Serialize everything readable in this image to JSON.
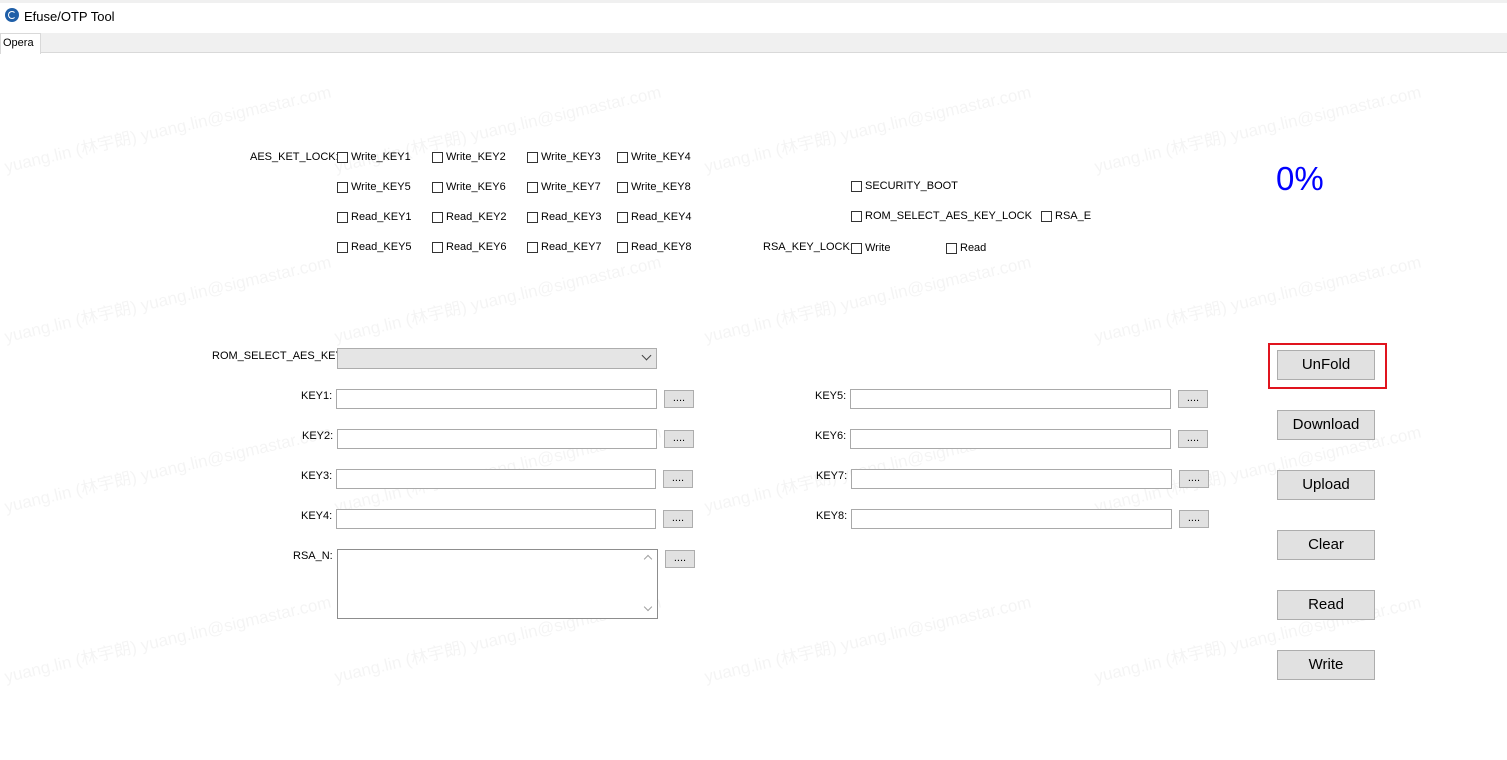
{
  "window": {
    "title": "Efuse/OTP Tool"
  },
  "tabs": [
    {
      "label": "Opera"
    }
  ],
  "aes_lock": {
    "label": "AES_KET_LOCK:",
    "rows": [
      [
        "Write_KEY1",
        "Write_KEY2",
        "Write_KEY3",
        "Write_KEY4"
      ],
      [
        "Write_KEY5",
        "Write_KEY6",
        "Write_KEY7",
        "Write_KEY8"
      ],
      [
        "Read_KEY1",
        "Read_KEY2",
        "Read_KEY3",
        "Read_KEY4"
      ],
      [
        "Read_KEY5",
        "Read_KEY6",
        "Read_KEY7",
        "Read_KEY8"
      ]
    ]
  },
  "security_boot": "SECURITY_BOOT",
  "rom_select_aes_key_lock": "ROM_SELECT_AES_KEY_LOCK",
  "rsa_e": "RSA_E",
  "rsa_lock": {
    "label": "RSA_KEY_LOCK:",
    "write": "Write",
    "read": "Read"
  },
  "rom_select": {
    "label": "ROM_SELECT_AES_KEY:",
    "value": ""
  },
  "keys_left": [
    {
      "label": "KEY1:",
      "value": ""
    },
    {
      "label": "KEY2:",
      "value": ""
    },
    {
      "label": "KEY3:",
      "value": ""
    },
    {
      "label": "KEY4:",
      "value": ""
    }
  ],
  "keys_right": [
    {
      "label": "KEY5:",
      "value": ""
    },
    {
      "label": "KEY6:",
      "value": ""
    },
    {
      "label": "KEY7:",
      "value": ""
    },
    {
      "label": "KEY8:",
      "value": ""
    }
  ],
  "rsa_n": {
    "label": "RSA_N:",
    "value": ""
  },
  "browse_label": "....",
  "progress": {
    "text": "0%",
    "value": 0
  },
  "buttons": {
    "unfold": "UnFold",
    "download": "Download",
    "upload": "Upload",
    "clear": "Clear",
    "read": "Read",
    "write": "Write"
  },
  "watermark": "yuang.lin (林宇朗) yuang.lin@sigmastar.com",
  "colors": {
    "progress": "#0000ff",
    "highlight": "#e0141e"
  }
}
